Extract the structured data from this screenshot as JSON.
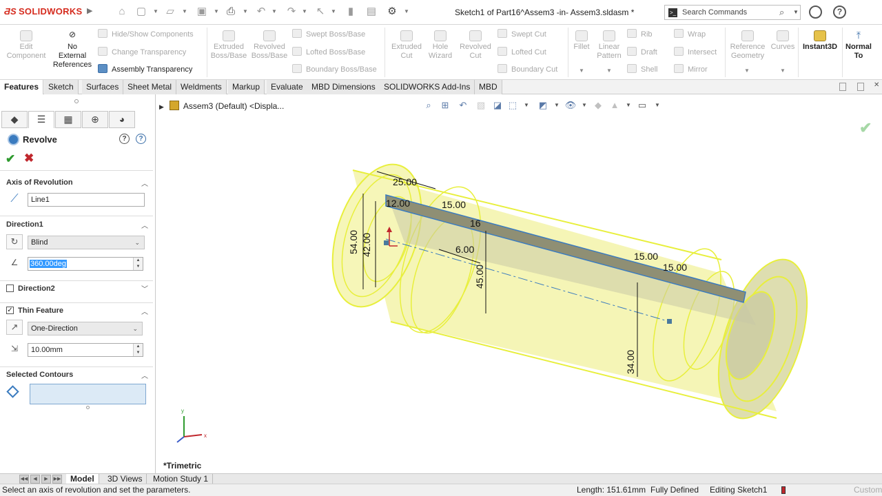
{
  "app": {
    "brand": "SOLIDWORKS",
    "doc_title": "Sketch1 of Part16^Assem3 -in- Assem3.sldasm *"
  },
  "search": {
    "placeholder": "Search Commands"
  },
  "commands": {
    "edit_component": "Edit\nComponent",
    "no_external": "No\nExternal\nReferences",
    "hide_show": "Hide/Show Components",
    "change_transparency": "Change Transparency",
    "assembly_transparency": "Assembly Transparency",
    "extruded_boss": "Extruded\nBoss/Base",
    "revolved_boss": "Revolved\nBoss/Base",
    "swept_boss": "Swept Boss/Base",
    "lofted_boss": "Lofted Boss/Base",
    "boundary_boss": "Boundary Boss/Base",
    "extruded_cut": "Extruded\nCut",
    "hole_wizard": "Hole\nWizard",
    "revolved_cut": "Revolved\nCut",
    "swept_cut": "Swept Cut",
    "lofted_cut": "Lofted Cut",
    "boundary_cut": "Boundary Cut",
    "fillet": "Fillet",
    "linear_pattern": "Linear\nPattern",
    "rib": "Rib",
    "draft": "Draft",
    "shell": "Shell",
    "wrap": "Wrap",
    "intersect": "Intersect",
    "mirror": "Mirror",
    "reference_geometry": "Reference\nGeometry",
    "curves": "Curves",
    "instant3d": "Instant3D",
    "normal_to": "Normal\nTo"
  },
  "tabs": [
    "Features",
    "Sketch",
    "Surfaces",
    "Sheet Metal",
    "Weldments",
    "Markup",
    "Evaluate",
    "MBD Dimensions",
    "SOLIDWORKS Add-Ins",
    "MBD"
  ],
  "active_tab": "Features",
  "property_manager": {
    "title": "Revolve",
    "axis_header": "Axis of Revolution",
    "axis_value": "Line1",
    "direction1_header": "Direction1",
    "direction1_type": "Blind",
    "angle": "360.00deg",
    "direction2_label": "Direction2",
    "thin_label": "Thin Feature",
    "thin_type": "One-Direction",
    "thickness": "10.00mm",
    "contours_header": "Selected Contours"
  },
  "viewport": {
    "breadcrumb": "Assem3 (Default) <Displa...",
    "view_name": "*Trimetric",
    "dims": [
      "25.00",
      "12.00",
      "15.00",
      "16",
      "54.00",
      "42.00",
      "6.00",
      "45.00",
      "15.00",
      "15.00",
      "34.00"
    ],
    "triad": {
      "x": "x",
      "y": "y"
    }
  },
  "bottom_tabs": [
    "Model",
    "3D Views",
    "Motion Study 1"
  ],
  "status": {
    "message": "Select an axis of revolution and set the parameters.",
    "length": "Length: 151.61mm",
    "defined": "Fully Defined",
    "editing": "Editing Sketch1",
    "units": "Custom"
  },
  "colors": {
    "brand_red": "#d52b1e",
    "model_fill": "#f3f3a0",
    "model_edge": "#e6ef3a",
    "selection_blue": "#3a7bbf"
  }
}
